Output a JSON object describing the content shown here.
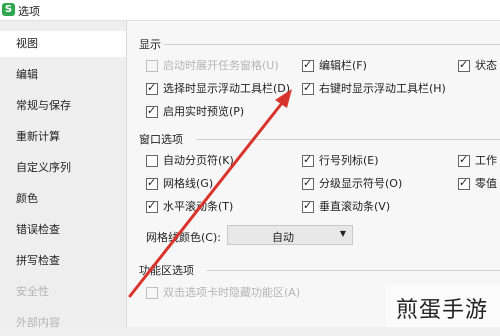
{
  "window": {
    "app_icon_glyph": "S",
    "title": "选项"
  },
  "sidebar": {
    "items": [
      {
        "label": "视图",
        "active": true
      },
      {
        "label": "编辑"
      },
      {
        "label": "常规与保存"
      },
      {
        "label": "重新计算"
      },
      {
        "label": "自定义序列"
      },
      {
        "label": "颜色"
      },
      {
        "label": "错误检查"
      },
      {
        "label": "拼写检查"
      },
      {
        "label": "安全性",
        "disabled": true
      },
      {
        "label": "外部内容",
        "disabled": true
      }
    ]
  },
  "display": {
    "title": "显示",
    "taskbar_window": {
      "label": "启动时展开任务窗格(U)",
      "checked": false,
      "disabled": true
    },
    "edit_bar": {
      "label": "编辑栏(F)",
      "checked": true
    },
    "status_bar": {
      "label": "状态",
      "checked": true
    },
    "float_toolbar_select": {
      "label": "选择时显示浮动工具栏(D)",
      "checked": true
    },
    "float_toolbar_right": {
      "label": "右键时显示浮动工具栏(H)",
      "checked": true
    },
    "live_preview": {
      "label": "启用实时预览(P)",
      "checked": true
    }
  },
  "window_options": {
    "title": "窗口选项",
    "auto_page_break": {
      "label": "自动分页符(K)",
      "checked": false
    },
    "row_col_header": {
      "label": "行号列标(E)",
      "checked": true
    },
    "sheet_tab": {
      "label": "工作",
      "checked": true
    },
    "gridlines": {
      "label": "网格线(G)",
      "checked": true
    },
    "outline_symbols": {
      "label": "分级显示符号(O)",
      "checked": true
    },
    "zero_values": {
      "label": "零值",
      "checked": true
    },
    "h_scrollbar": {
      "label": "水平滚动条(T)",
      "checked": true
    },
    "v_scrollbar": {
      "label": "垂直滚动条(V)",
      "checked": true
    },
    "grid_color_label": "网格线颜色(C):",
    "grid_color_value": "自动"
  },
  "ribbon": {
    "title": "功能区选项",
    "double_click_hide": {
      "label": "双击选项卡时隐藏功能区(A)",
      "checked": false,
      "disabled": true
    }
  },
  "annotation": {
    "arrow_color": "#d9342b"
  },
  "watermark": {
    "text": "煎蛋手游"
  }
}
